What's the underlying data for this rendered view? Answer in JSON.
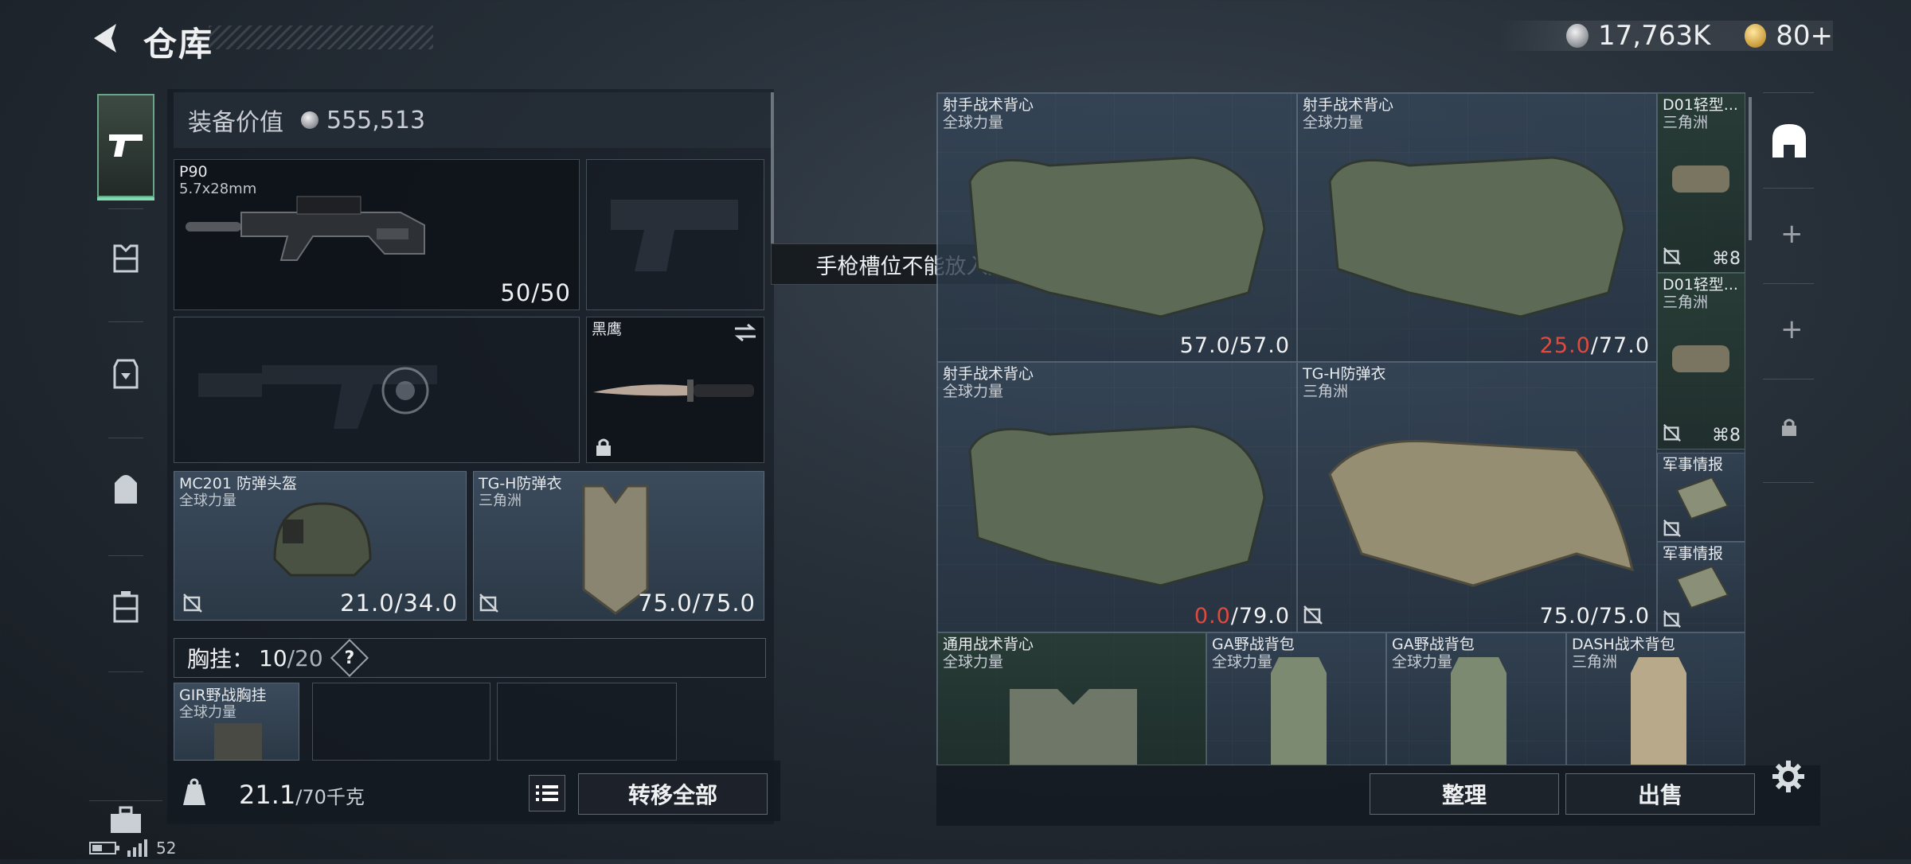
{
  "header": {
    "title": "仓库",
    "silver_amount": "17,763K",
    "gold_amount": "80+"
  },
  "nav": {
    "items": [
      "pistol-icon",
      "armor-icon",
      "backpack-rig-icon",
      "backpack-icon",
      "case-icon",
      "toolbox-icon"
    ]
  },
  "equip": {
    "value_label": "装备价值",
    "value": "555,513",
    "primary": {
      "name": "P90",
      "caliber": "5.7x28mm",
      "ammo": "50/50"
    },
    "melee": {
      "name": "黑鹰"
    },
    "helmet": {
      "name": "MC201 防弹头盔",
      "source": "全球力量",
      "durability": "21.0/34.0"
    },
    "armor": {
      "name": "TG-H防弹衣",
      "source": "三角洲",
      "durability": "75.0/75.0"
    },
    "chest_rig": {
      "label": "胸挂：",
      "used": "10",
      "total": "/20",
      "help": "?"
    },
    "rig_item": {
      "name": "GIR野战胸挂",
      "source": "全球力量"
    },
    "weight": {
      "current": "21.1",
      "max": "/70千克"
    },
    "transfer_all": "转移全部"
  },
  "tooltip": "手枪槽位不能放入此道具类型",
  "storage": {
    "items": [
      {
        "name": "射手战术背心",
        "source": "全球力量",
        "val_a": "57.0",
        "val_b": "/57.0",
        "red": false
      },
      {
        "name": "射手战术背心",
        "source": "全球力量",
        "val_a": "25.0",
        "val_b": "/77.0",
        "red": true
      },
      {
        "name": "D01轻型...",
        "source": "三角洲",
        "count": "8"
      },
      {
        "name": "D01轻型...",
        "source": "三角洲",
        "count": "8"
      },
      {
        "name": "射手战术背心",
        "source": "全球力量",
        "val_a": "0.0",
        "val_b": "/79.0",
        "red": true
      },
      {
        "name": "TG-H防弹衣",
        "source": "三角洲",
        "val_a": "75.0",
        "val_b": "/75.0",
        "red": false
      },
      {
        "name": "军事情报"
      },
      {
        "name": "军事情报"
      },
      {
        "name": "通用战术背心",
        "source": "全球力量"
      },
      {
        "name": "GA野战背包",
        "source": "全球力量"
      },
      {
        "name": "GA野战背包",
        "source": "全球力量"
      },
      {
        "name": "DASH战术背包",
        "source": "三角洲"
      }
    ],
    "sort": "整理",
    "sell": "出售"
  },
  "status": {
    "signal": "52"
  },
  "colors": {
    "accent_green": "#7fdcae",
    "damaged_red": "#e04a3e"
  }
}
